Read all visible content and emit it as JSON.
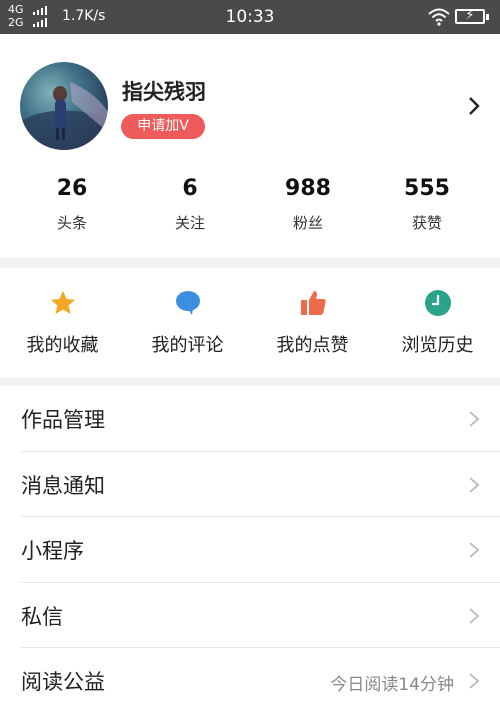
{
  "status_bar": {
    "network_top": "4G",
    "network_bottom": "2G",
    "speed": "1.7K/s",
    "time": "10:33"
  },
  "profile": {
    "username": "指尖残羽",
    "apply_badge": "申请加V",
    "stats": [
      {
        "value": "26",
        "label": "头条"
      },
      {
        "value": "6",
        "label": "关注"
      },
      {
        "value": "988",
        "label": "粉丝"
      },
      {
        "value": "555",
        "label": "获赞"
      }
    ]
  },
  "quick_actions": [
    {
      "label": "我的收藏",
      "icon": "star-icon",
      "color": "#f5a623"
    },
    {
      "label": "我的评论",
      "icon": "comment-icon",
      "color": "#3b8fe0"
    },
    {
      "label": "我的点赞",
      "icon": "thumbs-up-icon",
      "color": "#ef6a47"
    },
    {
      "label": "浏览历史",
      "icon": "clock-icon",
      "color": "#2aa38a"
    }
  ],
  "menu": [
    {
      "label": "作品管理",
      "extra": ""
    },
    {
      "label": "消息通知",
      "extra": ""
    },
    {
      "label": "小程序",
      "extra": ""
    },
    {
      "label": "私信",
      "extra": ""
    },
    {
      "label": "阅读公益",
      "extra": "今日阅读14分钟"
    }
  ],
  "colors": {
    "status_bar": "#4a4a4a",
    "badge": "#ef5a5a",
    "separator": "#f2f2f2"
  }
}
